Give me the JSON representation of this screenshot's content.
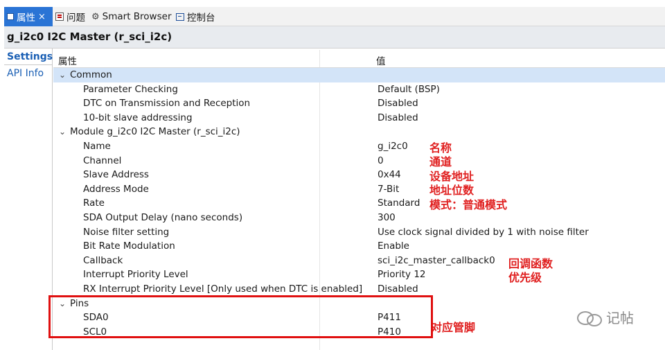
{
  "tabs": [
    {
      "label": "属性",
      "icon": "properties-icon",
      "active": true
    },
    {
      "label": "问题",
      "icon": "problems-icon"
    },
    {
      "label": "Smart Browser",
      "icon": "gear-icon"
    },
    {
      "label": "控制台",
      "icon": "console-icon"
    }
  ],
  "close_glyph": "×",
  "title": "g_i2c0 I2C Master (r_sci_i2c)",
  "side_tabs": [
    "Settings",
    "API Info"
  ],
  "table": {
    "header_property": "属性",
    "header_value": "值",
    "rows": [
      {
        "key": "Common",
        "value": "",
        "level": 0,
        "group": true
      },
      {
        "key": "Parameter Checking",
        "value": "Default (BSP)"
      },
      {
        "key": "DTC on Transmission and Reception",
        "value": "Disabled"
      },
      {
        "key": "10-bit slave addressing",
        "value": "Disabled"
      },
      {
        "key": "Module g_i2c0 I2C Master (r_sci_i2c)",
        "value": "",
        "level": 0,
        "group": true
      },
      {
        "key": "Name",
        "value": "g_i2c0"
      },
      {
        "key": "Channel",
        "value": "0"
      },
      {
        "key": "Slave Address",
        "value": "0x44"
      },
      {
        "key": "Address Mode",
        "value": "7-Bit"
      },
      {
        "key": "Rate",
        "value": "Standard"
      },
      {
        "key": "SDA Output Delay (nano seconds)",
        "value": "300"
      },
      {
        "key": "Noise filter setting",
        "value": "Use clock signal divided by 1 with noise filter"
      },
      {
        "key": "Bit Rate Modulation",
        "value": "Enable"
      },
      {
        "key": "Callback",
        "value": "sci_i2c_master_callback0"
      },
      {
        "key": "Interrupt Priority Level",
        "value": "Priority 12"
      },
      {
        "key": "RX Interrupt Priority Level [Only used when DTC is enabled]",
        "value": "Disabled"
      },
      {
        "key": "Pins",
        "value": "",
        "level": 0,
        "group": true
      },
      {
        "key": "SDA0",
        "value": "P411"
      },
      {
        "key": "SCL0",
        "value": "P410"
      }
    ]
  },
  "annotations": {
    "name": "名称",
    "channel": "通道",
    "slave_address": "设备地址",
    "address_mode": "地址位数",
    "rate": "模式：普通模式",
    "callback": "回调函数",
    "priority": "优先级",
    "pins": "对应管脚"
  },
  "annotation_color": "#e02020",
  "accent_color": "#2a74d5",
  "watermark": "记帖"
}
